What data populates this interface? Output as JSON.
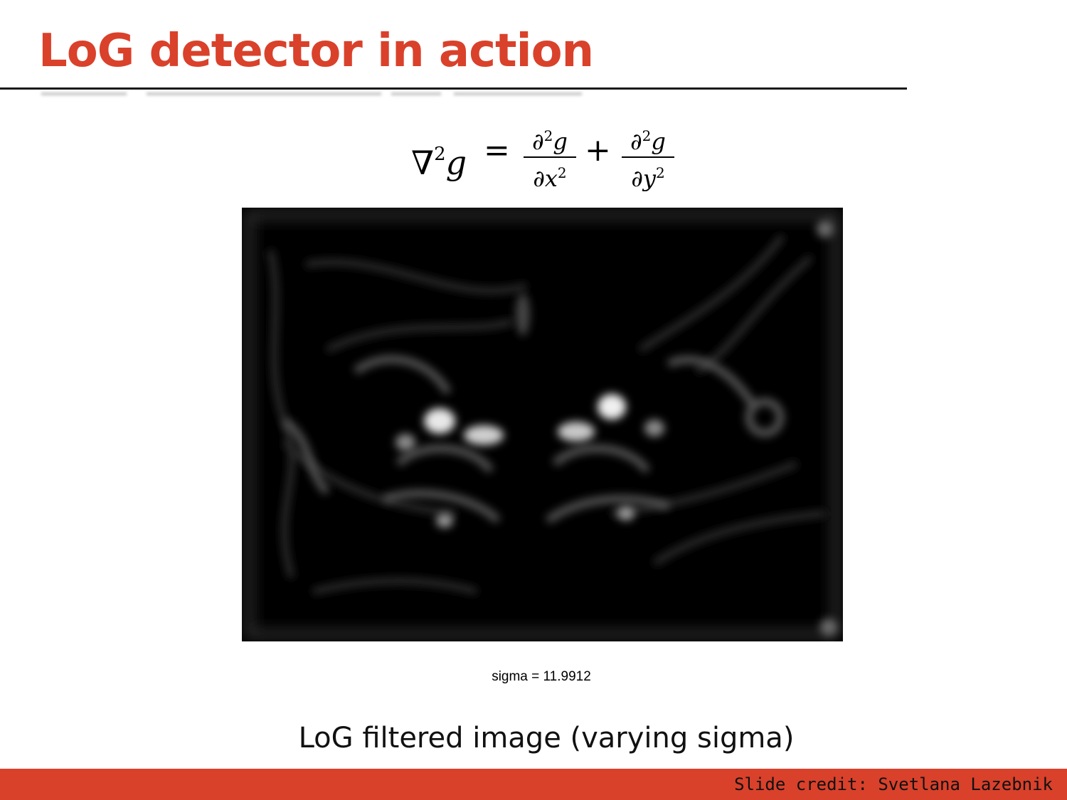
{
  "slide": {
    "title": "LoG detector in action",
    "formula": {
      "lhs": "∇²g",
      "equals": "=",
      "term1": {
        "numerator": "∂²g",
        "denominator": "∂x²"
      },
      "plus": "+",
      "term2": {
        "numerator": "∂²g",
        "denominator": "∂y²"
      }
    },
    "image": {
      "description_icon": "log-response-image",
      "sigma_label": "sigma = 11.9912"
    },
    "caption": "LoG filtered image (varying sigma)",
    "footer": {
      "credit": "Slide credit: Svetlana Lazebnik"
    }
  },
  "colors": {
    "accent": "#d9412b",
    "rule": "#1a1a1a",
    "image_bg": "#000000"
  }
}
